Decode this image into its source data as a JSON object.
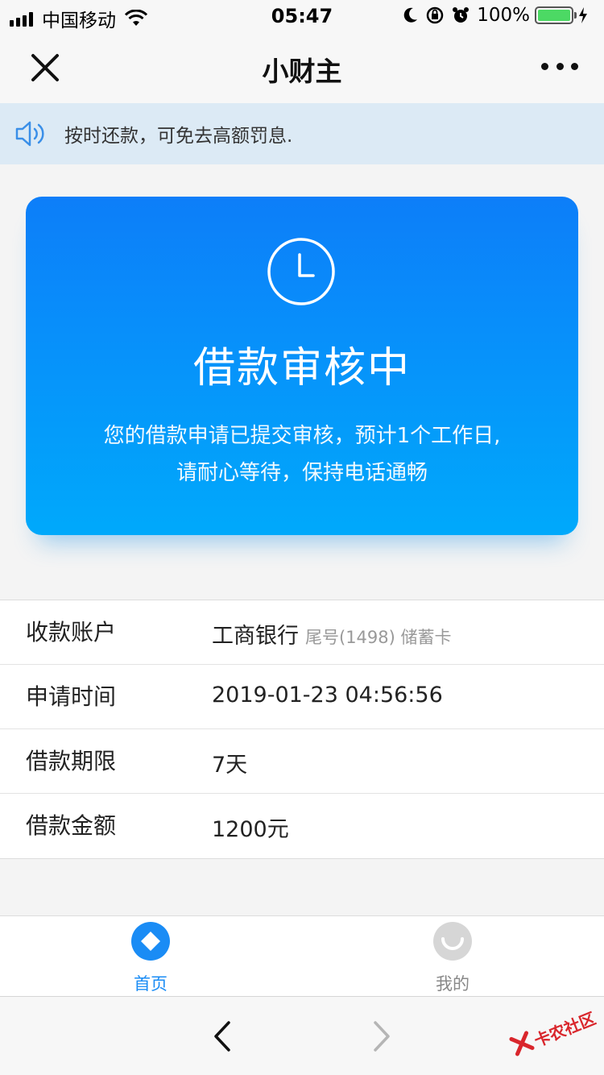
{
  "status_bar": {
    "carrier": "中国移动",
    "time": "05:47",
    "battery_pct": "100%",
    "battery_color": "#4cd964"
  },
  "nav": {
    "title": "小财主",
    "close_icon": "close-icon",
    "more_icon": "more-icon"
  },
  "notice": {
    "icon": "speaker-icon",
    "text": "按时还款，可免去高额罚息."
  },
  "card": {
    "icon": "clock-icon",
    "title": "借款审核中",
    "desc_line1": "您的借款申请已提交审核，预计1个工作日,",
    "desc_line2": "请耐心等待，保持电话通畅",
    "gradient_start": "#0d7ef9",
    "gradient_end": "#00a9fb"
  },
  "info": {
    "rows": [
      {
        "label": "收款账户",
        "value": "工商银行",
        "sub": "尾号(1498) 储蓄卡"
      },
      {
        "label": "申请时间",
        "value": "2019-01-23 04:56:56"
      },
      {
        "label": "借款期限",
        "value": "7天"
      },
      {
        "label": "借款金额",
        "value": "1200元"
      }
    ]
  },
  "tabs": {
    "home_label": "首页",
    "mine_label": "我的",
    "active_color": "#1a8cf5",
    "inactive_color": "#888888"
  },
  "browser": {
    "back_icon": "chevron-left-icon",
    "forward_icon": "chevron-right-icon",
    "watermark": "卡农社区"
  }
}
